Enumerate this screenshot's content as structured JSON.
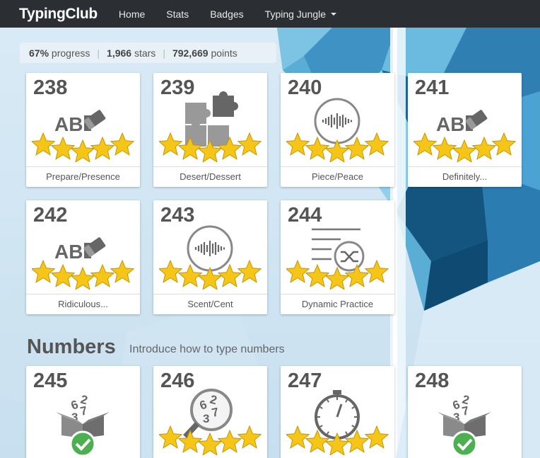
{
  "navbar": {
    "logo": "TypingClub",
    "items": [
      {
        "label": "Home"
      },
      {
        "label": "Stats"
      },
      {
        "label": "Badges"
      },
      {
        "label": "Typing Jungle"
      }
    ]
  },
  "progress": {
    "percent": "67%",
    "percent_label": "progress",
    "stars": "1,966",
    "stars_label": "stars",
    "points": "792,669",
    "points_label": "points"
  },
  "lessons": [
    {
      "number": "238",
      "label": "Prepare/Presence",
      "icon": "abc-eraser-icon",
      "stars": 5
    },
    {
      "number": "239",
      "label": "Desert/Dessert",
      "icon": "puzzle-icon",
      "stars": 5
    },
    {
      "number": "240",
      "label": "Piece/Peace",
      "icon": "audio-wave-icon",
      "stars": 5
    },
    {
      "number": "241",
      "label": "Definitely...",
      "icon": "abc-eraser-icon",
      "stars": 5
    },
    {
      "number": "242",
      "label": "Ridiculous...",
      "icon": "abc-eraser-icon",
      "stars": 5
    },
    {
      "number": "243",
      "label": "Scent/Cent",
      "icon": "audio-wave-icon",
      "stars": 5
    },
    {
      "number": "244",
      "label": "Dynamic Practice",
      "icon": "shuffle-list-icon",
      "stars": 5
    }
  ],
  "numbers_section": {
    "title": "Numbers",
    "subtitle": "Introduce how to type numbers",
    "lessons": [
      {
        "number": "245",
        "icon": "number-box-check-icon",
        "stars": 0,
        "digits": [
          "6",
          "2",
          "3",
          "7"
        ]
      },
      {
        "number": "246",
        "icon": "magnifier-numbers-icon",
        "stars": 5,
        "digits": [
          "6",
          "2",
          "3",
          "7"
        ]
      },
      {
        "number": "247",
        "icon": "stopwatch-icon",
        "stars": 5
      },
      {
        "number": "248",
        "icon": "number-box-check-icon",
        "stars": 0,
        "digits": [
          "6",
          "2",
          "3",
          "7"
        ]
      }
    ]
  },
  "colors": {
    "navbar": "#2b2f33",
    "star": "#f5c518",
    "check": "#4caf50",
    "text": "#555555"
  }
}
